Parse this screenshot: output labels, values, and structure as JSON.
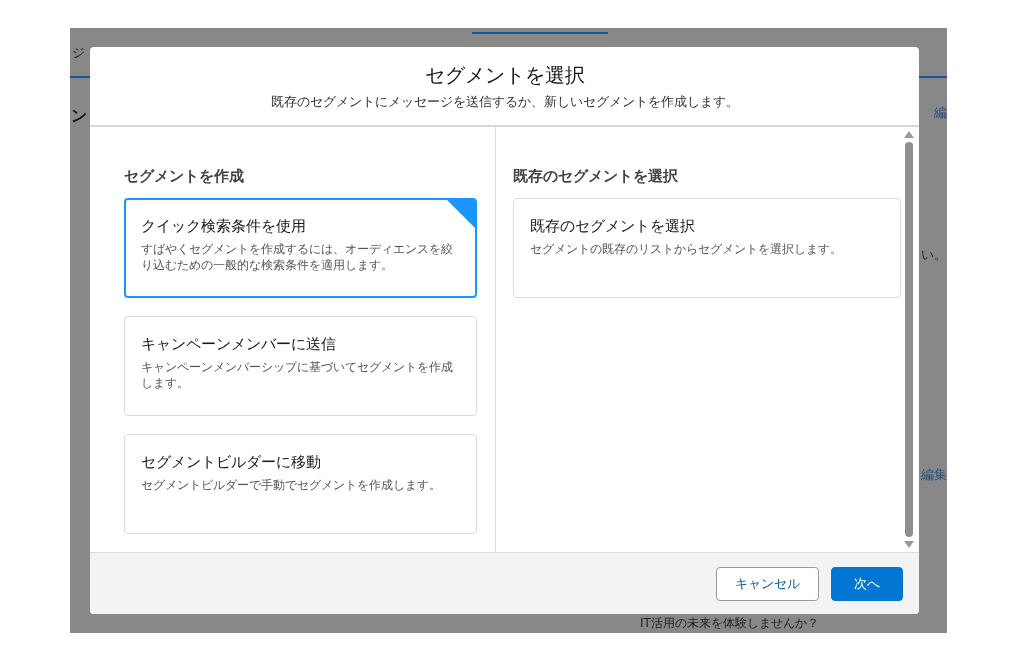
{
  "background": {
    "texts": [
      {
        "kind": "tab",
        "text": "ジ"
      },
      {
        "kind": "heading",
        "text": "ン"
      },
      {
        "kind": "link",
        "text": "編"
      },
      {
        "kind": "plain",
        "text": "い。"
      },
      {
        "kind": "link",
        "text": "編集"
      },
      {
        "kind": "plain",
        "text": "IT活用の未来を体験しませんか？"
      }
    ]
  },
  "dialog": {
    "title": "セグメントを選択",
    "subtitle": "既存のセグメントにメッセージを送信するか、新しいセグメントを作成します。",
    "create": {
      "heading": "セグメントを作成",
      "options": [
        {
          "title": "クイック検索条件を使用",
          "description": "すばやくセグメントを作成するには、オーディエンスを絞り込むための一般的な検索条件を適用します。",
          "selected": true
        },
        {
          "title": "キャンペーンメンバーに送信",
          "description": "キャンペーンメンバーシップに基づいてセグメントを作成します。",
          "selected": false
        },
        {
          "title": "セグメントビルダーに移動",
          "description": "セグメントビルダーで手動でセグメントを作成します。",
          "selected": false
        }
      ]
    },
    "existing": {
      "heading": "既存のセグメントを選択",
      "options": [
        {
          "title": "既存のセグメントを選択",
          "description": "セグメントの既存のリストからセグメントを選択します。",
          "selected": false
        }
      ]
    },
    "buttons": [
      {
        "kind": "neutral",
        "label": "キャンセル"
      },
      {
        "kind": "brand",
        "label": "次へ"
      }
    ]
  }
}
